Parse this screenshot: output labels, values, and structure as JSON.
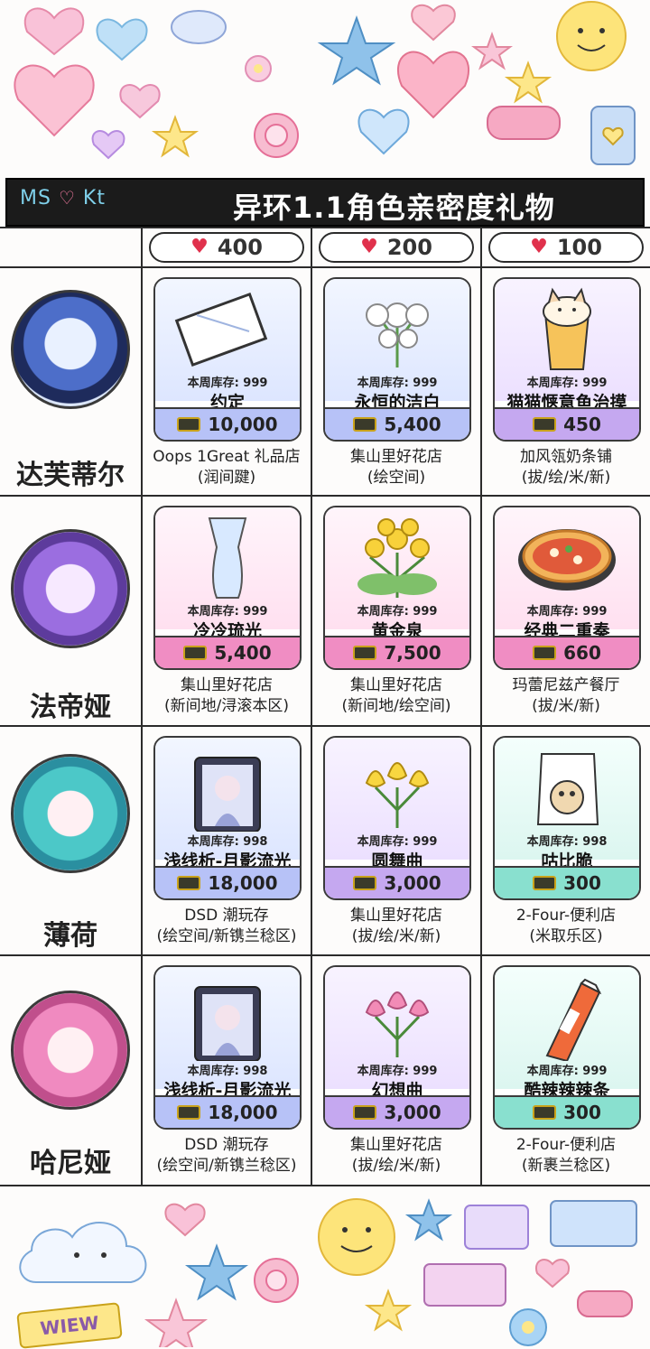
{
  "header": {
    "logo_text": "MS",
    "logo_tail": "Kt",
    "title": "异环1.1角色亲密度礼物"
  },
  "costs": [
    "400",
    "200",
    "100"
  ],
  "characters": [
    {
      "name": "达芙蒂尔",
      "items": [
        {
          "stock": "本周库存: 999",
          "name": "约定",
          "price": "10,000",
          "shop": "Oops 1Great 礼品店",
          "area": "(润间踺)",
          "theme": "blue"
        },
        {
          "stock": "本周库存: 999",
          "name": "永恒的洁白",
          "price": "5,400",
          "shop": "集山里好花店",
          "area": "(绘空间)",
          "theme": "blue"
        },
        {
          "stock": "本周库存: 999",
          "name": "猫猫惬意鱼治摸",
          "price": "450",
          "shop": "加风瓴奶条铺",
          "area": "(拔/绘/米/新)",
          "theme": "purple"
        }
      ]
    },
    {
      "name": "法帝娅",
      "items": [
        {
          "stock": "本周库存: 999",
          "name": "冷冷琉光",
          "price": "5,400",
          "shop": "集山里好花店",
          "area": "(新间地/浔滚本区)",
          "theme": "pink"
        },
        {
          "stock": "本周库存: 999",
          "name": "黄金泉",
          "price": "7,500",
          "shop": "集山里好花店",
          "area": "(新间地/绘空间)",
          "theme": "pink"
        },
        {
          "stock": "本周库存: 999",
          "name": "经典二重奏",
          "price": "660",
          "shop": "玛蕾尼兹产餐厅",
          "area": "(拔/米/新)",
          "theme": "pink"
        }
      ]
    },
    {
      "name": "薄荷",
      "items": [
        {
          "stock": "本周库存: 998",
          "name": "浅线析-月影流光",
          "price": "18,000",
          "shop": "DSD 潮玩存",
          "area": "(绘空间/新镌兰稔区)",
          "theme": "blue"
        },
        {
          "stock": "本周库存: 999",
          "name": "圆舞曲",
          "price": "3,000",
          "shop": "集山里好花店",
          "area": "(拔/绘/米/新)",
          "theme": "purple"
        },
        {
          "stock": "本周库存: 998",
          "name": "咕比脆",
          "price": "300",
          "shop": "2-Four-便利店",
          "area": "(米取乐区)",
          "theme": "teal"
        }
      ]
    },
    {
      "name": "哈尼娅",
      "items": [
        {
          "stock": "本周库存: 998",
          "name": "浅线析-月影流光",
          "price": "18,000",
          "shop": "DSD 潮玩存",
          "area": "(绘空间/新镌兰稔区)",
          "theme": "blue"
        },
        {
          "stock": "本周库存: 999",
          "name": "幻想曲",
          "price": "3,000",
          "shop": "集山里好花店",
          "area": "(拔/绘/米/新)",
          "theme": "purple"
        },
        {
          "stock": "本周库存: 999",
          "name": "酷辣辣辣条",
          "price": "300",
          "shop": "2-Four-便利店",
          "area": "(新裹兰稔区)",
          "theme": "teal"
        }
      ]
    }
  ],
  "footer": {
    "sticker_text": "WIEW"
  },
  "colors": {
    "title_bg": "#1b1b1b",
    "heart_red": "#e0314c",
    "blue_bar": "#b7c2f7",
    "pink_bar": "#f08dc3",
    "purple_bar": "#c5a8f0",
    "teal_bar": "#89e0cf"
  }
}
